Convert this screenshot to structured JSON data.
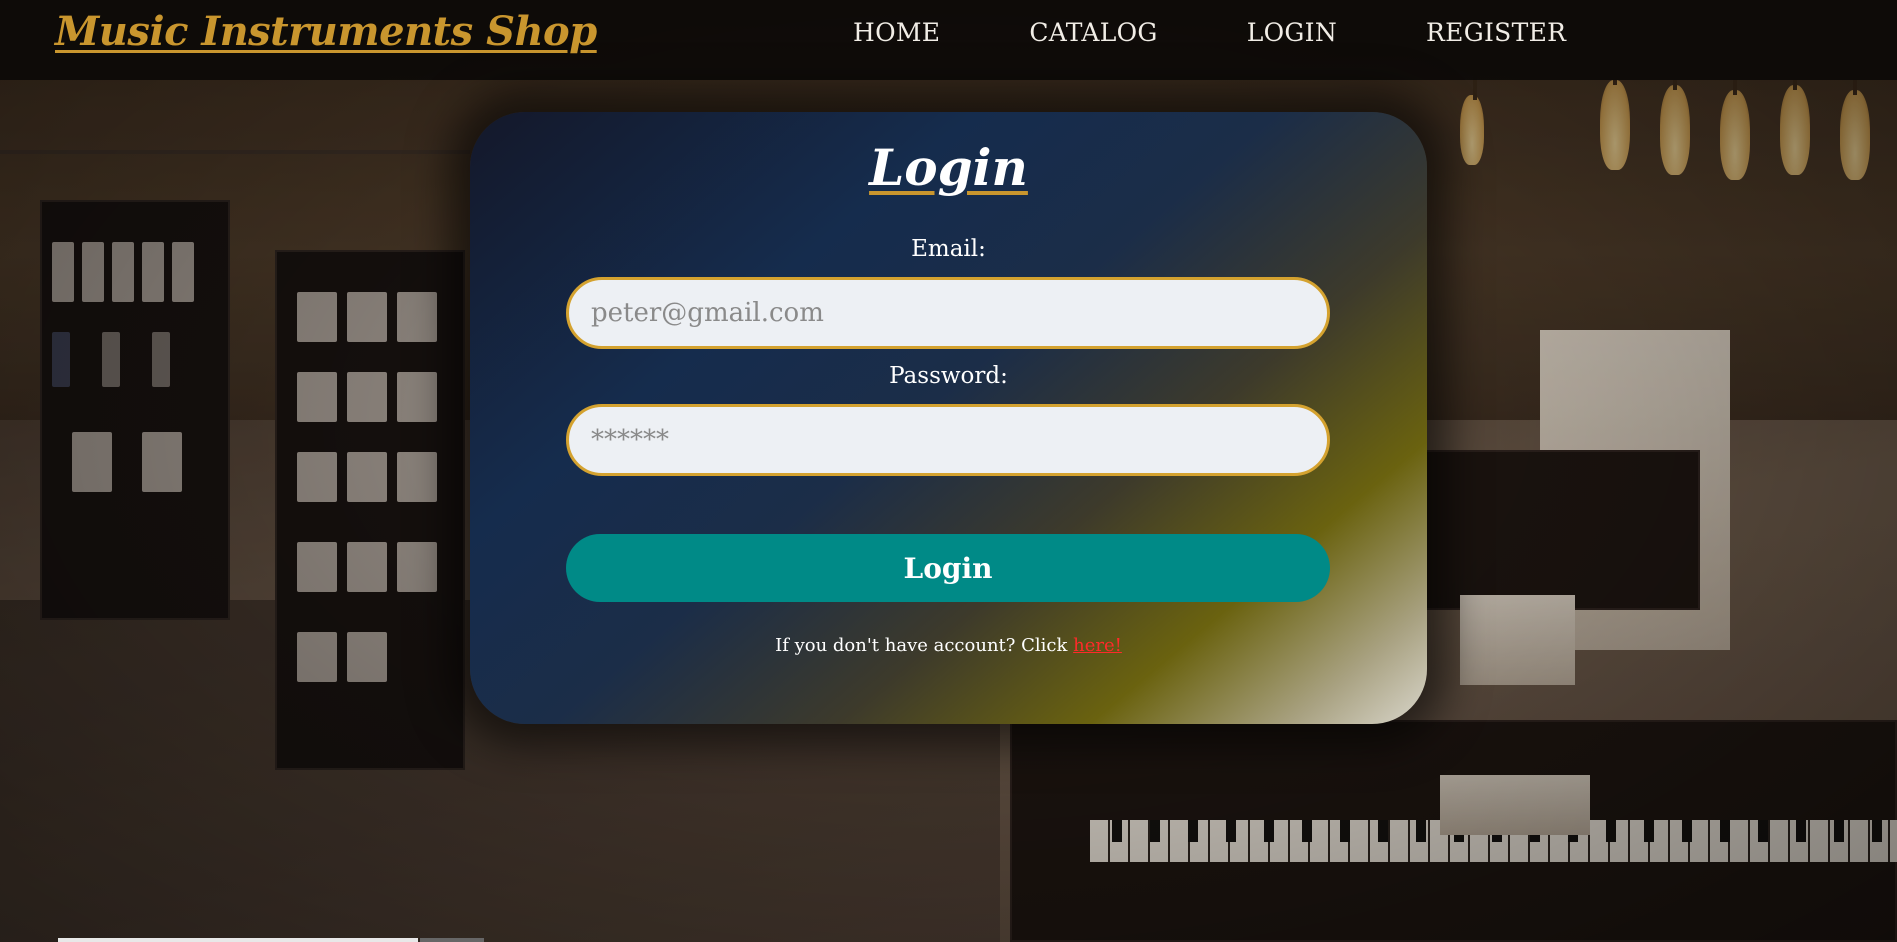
{
  "header": {
    "brand": "Music Instruments Shop",
    "nav": [
      {
        "label": "HOME"
      },
      {
        "label": "CATALOG"
      },
      {
        "label": "LOGIN"
      },
      {
        "label": "REGISTER"
      }
    ]
  },
  "login_form": {
    "title": "Login",
    "email_label": "Email:",
    "email_placeholder": "peter@gmail.com",
    "password_label": "Password:",
    "password_placeholder": "******",
    "submit_label": "Login",
    "register_prompt": "If you don't have account? Click",
    "register_link": "here!"
  },
  "colors": {
    "brand": "#c9962e",
    "input_border": "#d4a22f",
    "button": "#008a87",
    "link": "#ff2a2a"
  }
}
